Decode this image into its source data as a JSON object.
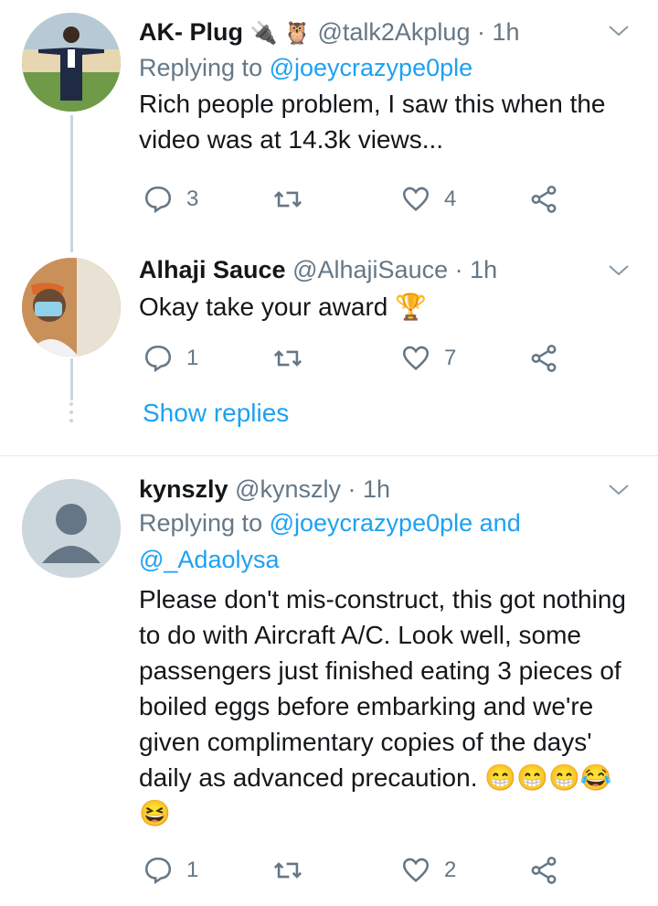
{
  "tweets": [
    {
      "name": "AK- Plug",
      "name_emoji": "🔌 🦉",
      "handle": "@talk2Akplug",
      "time": "· 1h",
      "replying_label": "Replying to",
      "replying_to": "@joeycrazype0ple",
      "text": "Rich people problem, I saw this when the video was at 14.3k views...",
      "replies": "3",
      "retweets": "",
      "likes": "4"
    },
    {
      "name": "Alhaji Sauce",
      "handle": "@AlhajiSauce",
      "time": "· 1h",
      "text": "Okay take your award",
      "text_emoji": "🏆",
      "replies": "1",
      "retweets": "",
      "likes": "7"
    },
    {
      "name": "kynszly",
      "handle": "@kynszly",
      "time": "· 1h",
      "replying_label": "Replying to",
      "replying_to": "@joeycrazype0ple",
      "replying_and": "and",
      "replying_to_2": "@_Adaolysa",
      "text": "Please don't mis-construct, this got nothing to do with Aircraft A/C. Look well, some passengers just finished eating 3 pieces of boiled eggs before embarking and we're given complimentary copies of the days' daily as advanced precaution.",
      "text_emoji": "😁😁😁😂😆",
      "replies": "1",
      "retweets": "",
      "likes": "2"
    }
  ],
  "show_replies": "Show replies",
  "colors": {
    "accent": "#1da1f2",
    "muted": "#657786",
    "text": "#14171a",
    "line": "#ccd6dd"
  }
}
